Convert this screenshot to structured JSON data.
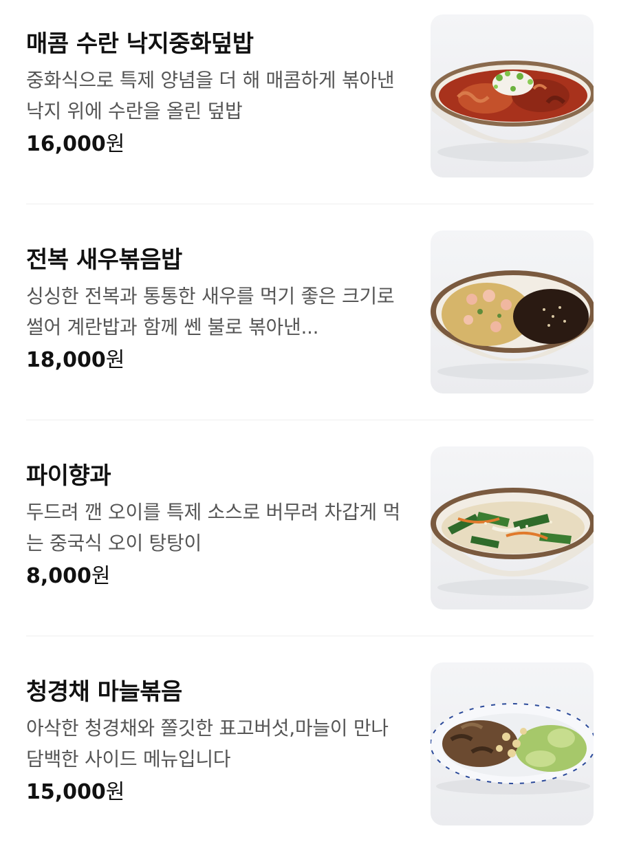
{
  "menu": {
    "items": [
      {
        "name": "매콤 수란 낙지중화덮밥",
        "description": "중화식으로 특제 양념을 더 해 매콤하게 볶아낸 낙지 위에 수란을 올린 덮밥",
        "price": "16,000",
        "currency": "원",
        "image": "spicy-octopus-rice-bowl-photo"
      },
      {
        "name": "전복 새우볶음밥",
        "description": "싱싱한 전복과 통통한 새우를 먹기 좋은 크기로 썰어 계란밥과 함께 쎈 불로 볶아낸...",
        "price": "18,000",
        "currency": "원",
        "image": "abalone-shrimp-fried-rice-photo"
      },
      {
        "name": "파이향과",
        "description": "두드려 깬 오이를 특제 소스로 버무려 차갑게 먹는 중국식 오이 탕탕이",
        "price": "8,000",
        "currency": "원",
        "image": "smashed-cucumber-salad-photo"
      },
      {
        "name": "청경채 마늘볶음",
        "description": "아삭한 청경채와 쫄깃한 표고버섯,마늘이 만나 담백한 사이드 메뉴입니다",
        "price": "15,000",
        "currency": "원",
        "image": "bok-choy-garlic-stirfry-photo"
      }
    ]
  },
  "colors": {
    "background": "#ffffff",
    "title_text": "#111111",
    "description_text": "#555555",
    "divider": "#eeeeee",
    "photo_background": "#f0f1f3"
  }
}
